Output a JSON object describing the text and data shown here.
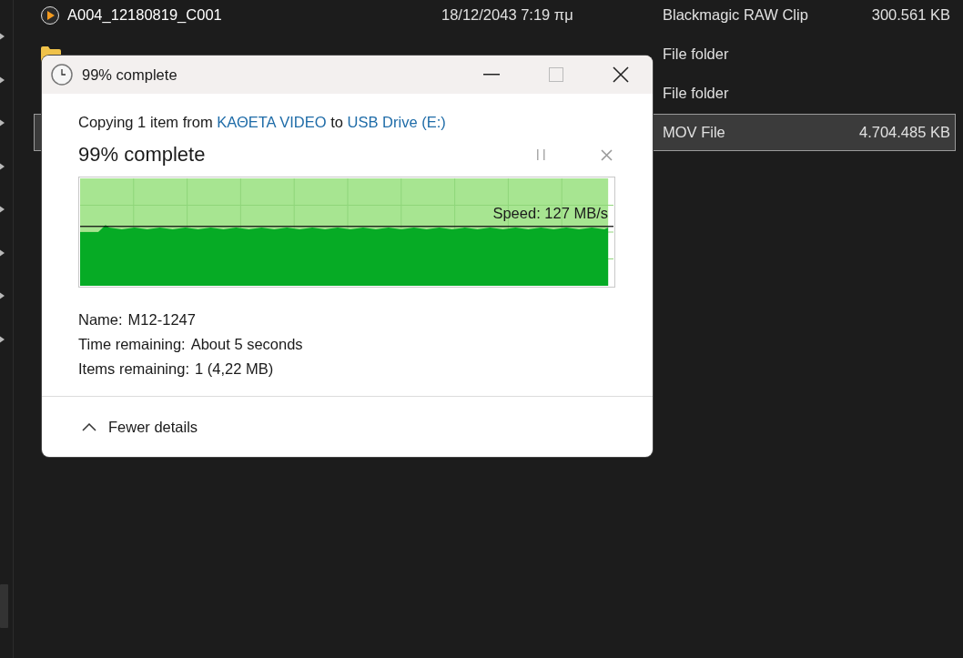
{
  "explorer": {
    "rows": [
      {
        "kind": "clip",
        "name": "A004_12180819_C001",
        "date": "18/12/2043 7:19 πμ",
        "type": "Blackmagic RAW Clip",
        "size": "300.561 KB",
        "selected": false
      },
      {
        "kind": "folder",
        "type": "File folder",
        "selected": false
      },
      {
        "type": "File folder",
        "selected": false
      },
      {
        "type": "MOV File",
        "size": "4.704.485 KB",
        "selected": true
      }
    ]
  },
  "dialog": {
    "title": "99% complete",
    "copy_line": {
      "prefix": "Copying 1 item from",
      "source": "ΚΑΘΕΤΑ VIDEO",
      "middle": "to",
      "destination": "USB Drive (E:)"
    },
    "heading": "99% complete",
    "progress": {
      "level": 0.99,
      "speed": "Speed: 127 MB/s"
    },
    "details": [
      {
        "label": "Name:",
        "value": "M12-1247"
      },
      {
        "label": "Time remaining:",
        "value": "About 5 seconds"
      },
      {
        "label": "Items remaining:",
        "value": "1 (4,22 MB)"
      }
    ],
    "toggle": {
      "label": "Fewer details",
      "expanded": true
    }
  }
}
